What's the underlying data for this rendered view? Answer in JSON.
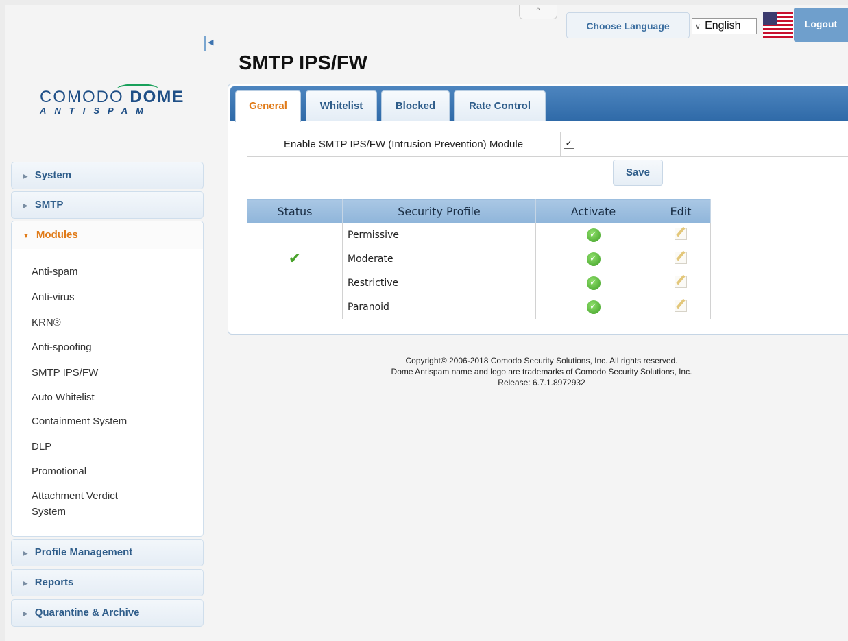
{
  "header": {
    "choose_language": "Choose Language",
    "language_selected": "English",
    "logout": "Logout"
  },
  "logo": {
    "word1": "COMODO",
    "word2": "DOME",
    "sub": "ANTISPAM"
  },
  "sidebar": {
    "items": [
      {
        "label": "System",
        "expanded": false
      },
      {
        "label": "SMTP",
        "expanded": false
      },
      {
        "label": "Modules",
        "expanded": true
      },
      {
        "label": "Profile Management",
        "expanded": false
      },
      {
        "label": "Reports",
        "expanded": false
      },
      {
        "label": "Quarantine & Archive",
        "expanded": false
      }
    ],
    "modules_sub": [
      "Anti-spam",
      "Anti-virus",
      "KRN®",
      "Anti-spoofing",
      "SMTP IPS/FW",
      "Auto Whitelist",
      "Containment System",
      "DLP",
      "Promotional",
      "Attachment Verdict",
      "System"
    ]
  },
  "main": {
    "title": "SMTP IPS/FW",
    "tabs": [
      "General",
      "Whitelist",
      "Blocked",
      "Rate Control"
    ],
    "active_tab": "General",
    "enable_label": "Enable SMTP IPS/FW (Intrusion Prevention) Module",
    "enable_checked": true,
    "save": "Save",
    "table": {
      "headers": [
        "Status",
        "Security Profile",
        "Activate",
        "Edit"
      ],
      "rows": [
        {
          "status_active": false,
          "profile": "Permissive"
        },
        {
          "status_active": true,
          "profile": "Moderate"
        },
        {
          "status_active": false,
          "profile": "Restrictive"
        },
        {
          "status_active": false,
          "profile": "Paranoid"
        }
      ]
    }
  },
  "footer": {
    "line1": "Copyright© 2006-2018 Comodo Security Solutions, Inc. All rights reserved.",
    "line2": "Dome Antispam name and logo are trademarks of Comodo Security Solutions, Inc.",
    "line3": "Release: 6.7.1.8972932"
  },
  "colors": {
    "accent_orange": "#e07b19",
    "nav_blue": "#2f5d8a",
    "tabbar_blue": "#3d74b0"
  }
}
